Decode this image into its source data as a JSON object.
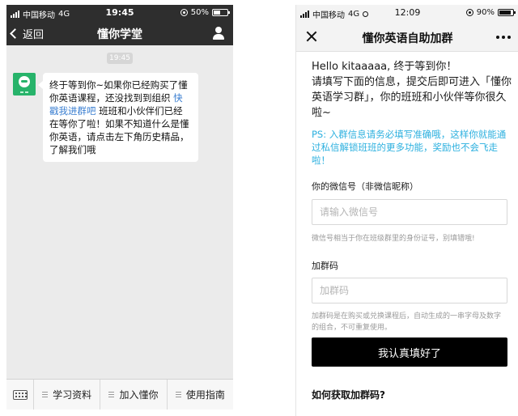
{
  "left_phone": {
    "status_bar": {
      "carrier": "中国移动",
      "network": "4G",
      "time": "19:45",
      "battery": "50%",
      "battery_level": 0.5
    },
    "nav": {
      "back_label": "返回",
      "title": "懂你学堂"
    },
    "chat": {
      "timestamp": "19:45",
      "message_part1": "终于等到你~如果你已经购买了懂你英语课程，还没找到到组织 ",
      "message_link": "快戳我进群吧",
      "message_part2": " 班班和小伙伴们已经在等你了啦！如果不知道什么是懂你英语，请点击左下角历史精品，了解我们哦"
    },
    "bottom_menu": {
      "items": [
        "学习资料",
        "加入懂你",
        "使用指南"
      ]
    }
  },
  "right_phone": {
    "status_bar": {
      "carrier": "中国移动",
      "network": "4G",
      "time": "12:09",
      "battery": "90%",
      "battery_level": 0.9
    },
    "nav": {
      "title": "懂你英语自助加群"
    },
    "greeting_line1": "Hello kitaaaaa, 终于等到你！",
    "greeting_line2": "请填写下面的信息，提交后即可进入「懂你英语学习群」，你的班班和小伙伴等你很久啦~",
    "ps_note": "PS: 入群信息请务必填写准确哦，这样你就能通过私信解锁班班的更多功能，奖励也不会飞走啦！",
    "wechat_field": {
      "label": "你的微信号（非微信昵称）",
      "placeholder": "请输入微信号",
      "hint": "微信号相当于你在班级群里的身份证号，别填错哦!"
    },
    "code_field": {
      "label": "加群码",
      "placeholder": "加群码",
      "hint": "加群码是在购买或兑换课程后，自动生成的一串字母及数字的组合，不可重复使用。"
    },
    "submit_label": "我认真填好了",
    "faq_heading": "如何获取加群码?"
  },
  "colors": {
    "dark_bar": "#2e2e2e",
    "chat_bg": "#ebebeb",
    "link": "#3b7fd1",
    "ps_note": "#2cb0df",
    "brand_green": "#27b36a",
    "submit_bg": "#000000"
  }
}
